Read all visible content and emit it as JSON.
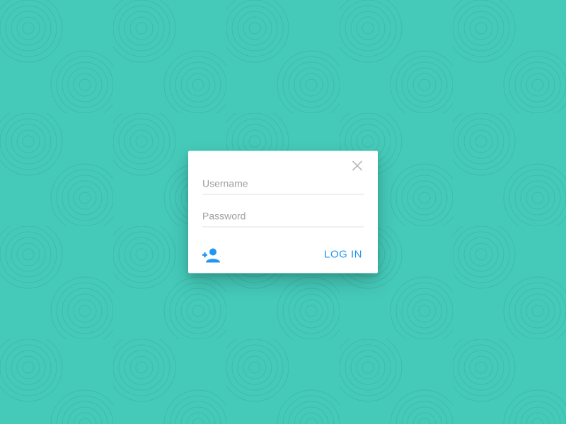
{
  "form": {
    "username": {
      "label": "Username",
      "value": ""
    },
    "password": {
      "label": "Password",
      "value": ""
    }
  },
  "actions": {
    "login_label": "LOG IN"
  },
  "colors": {
    "accent": "#2196f3",
    "background": "#45cab9"
  }
}
